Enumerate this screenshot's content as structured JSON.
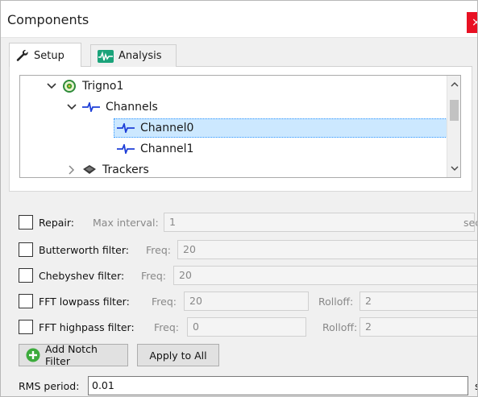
{
  "window": {
    "title": "Components",
    "close_glyph": "×"
  },
  "tabs": [
    {
      "label": "Setup",
      "icon": "wrench-icon",
      "active": true
    },
    {
      "label": "Analysis",
      "icon": "waveform-icon",
      "active": false
    }
  ],
  "tree": {
    "nodes": [
      {
        "label": "Trigno1",
        "icon": "device-icon",
        "expanded": true,
        "depth": 0
      },
      {
        "label": "Channels",
        "icon": "signal-icon",
        "expanded": true,
        "depth": 1
      },
      {
        "label": "Channel0",
        "icon": "signal-icon",
        "selected": true,
        "depth": 2
      },
      {
        "label": "Channel1",
        "icon": "signal-icon",
        "depth": 2
      },
      {
        "label": "Trackers",
        "icon": "tracker-icon",
        "expanded": false,
        "depth": 1
      }
    ]
  },
  "filters": {
    "repair": {
      "label": "Repair:",
      "sub_label": "Max interval:",
      "value": "1",
      "unit": "sec",
      "checked": false
    },
    "butterworth": {
      "label": "Butterworth filter:",
      "sub_label": "Freq:",
      "value": "20",
      "checked": false
    },
    "chebyshev": {
      "label": "Chebyshev filter:",
      "sub_label": "Freq:",
      "value": "20",
      "checked": false
    },
    "fft_lowpass": {
      "label": "FFT lowpass filter:",
      "sub_label": "Freq:",
      "value": "20",
      "rolloff_label": "Rolloff:",
      "rolloff_value": "2",
      "checked": false
    },
    "fft_highpass": {
      "label": "FFT highpass filter:",
      "sub_label": "Freq:",
      "value": "0",
      "rolloff_label": "Rolloff:",
      "rolloff_value": "2",
      "checked": false
    }
  },
  "buttons": {
    "add_notch": "Add Notch Filter",
    "apply_all": "Apply to All"
  },
  "rms": {
    "label": "RMS period:",
    "value": "0.01",
    "unit": "s"
  },
  "colors": {
    "accent": "#3399ff",
    "selection": "#cce8ff",
    "signal_blue": "#1e3fd8",
    "notch_green": "#3cab3c",
    "close_red": "#e81123"
  }
}
